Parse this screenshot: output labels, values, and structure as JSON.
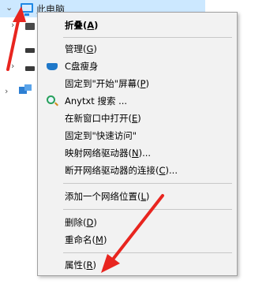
{
  "tree": {
    "this_pc_label": "此电脑"
  },
  "menu": {
    "items": [
      {
        "label": "折叠",
        "key": "A"
      },
      {
        "label": "管理",
        "key": "G"
      },
      {
        "label": "C盘瘦身",
        "key": ""
      },
      {
        "label": "固定到\"开始\"屏幕",
        "key": "P"
      },
      {
        "label": "Anytxt 搜索 ...",
        "key": ""
      },
      {
        "label": "在新窗口中打开",
        "key": "E"
      },
      {
        "label": "固定到\"快速访问\"",
        "key": ""
      },
      {
        "label": "映射网络驱动器",
        "key": "N",
        "suffix": "..."
      },
      {
        "label": "断开网络驱动器的连接",
        "key": "C",
        "suffix": "..."
      },
      {
        "label": "添加一个网络位置",
        "key": "L"
      },
      {
        "label": "删除",
        "key": "D"
      },
      {
        "label": "重命名",
        "key": "M"
      },
      {
        "label": "属性",
        "key": "R"
      }
    ]
  },
  "colors": {
    "annotation": "#e8251f",
    "selection": "#cce8ff",
    "menu_bg": "#f2f2f2"
  }
}
